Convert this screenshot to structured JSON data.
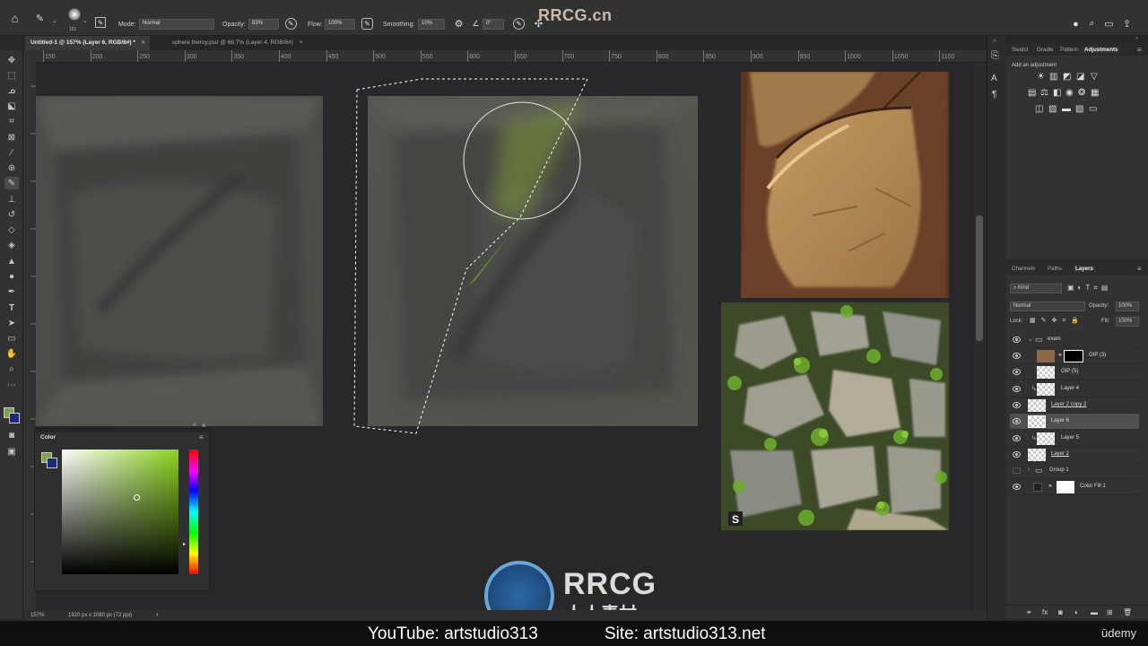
{
  "options_bar": {
    "brush_size": "151",
    "mode_label": "Mode:",
    "mode_value": "Normal",
    "opacity_label": "Opacity:",
    "opacity_value": "83%",
    "flow_label": "Flow:",
    "flow_value": "100%",
    "smoothing_label": "Smoothing:",
    "smoothing_value": "10%",
    "angle_value": "0°"
  },
  "document_tabs": [
    {
      "label": "Untitled-1 @ 157% (Layer 6, RGB/8#) *",
      "active": true
    },
    {
      "label": "sphere theroy.psd @ 66.7% (Layer 4, RGB/8#)",
      "active": false
    }
  ],
  "ruler": {
    "ticks": [
      "150",
      "200",
      "250",
      "300",
      "350",
      "400",
      "450",
      "500",
      "550",
      "600",
      "650",
      "700",
      "750",
      "800",
      "850",
      "900",
      "950",
      "1000",
      "1050",
      "1100"
    ]
  },
  "status": {
    "zoom": "157%",
    "doc_info": "1920 px x 1080 px (72 ppi)"
  },
  "color_panel": {
    "title": "Color",
    "foreground": "#7ea24a",
    "background": "#1d2a7a",
    "hue": "#8bd41e"
  },
  "panels_top": {
    "tabs": [
      "Swatcl",
      "Gradie",
      "Pattern",
      "Adjustments"
    ],
    "active_tab": "Adjustments",
    "hint": "Add an adjustment"
  },
  "layers_panel": {
    "tabs": [
      "Channels",
      "Paths",
      "Layers"
    ],
    "active_tab": "Layers",
    "filter": "Kind",
    "blend_mode": "Normal",
    "opacity_label": "Opacity:",
    "opacity_value": "100%",
    "lock_label": "Lock:",
    "fill_label": "Fill:",
    "fill_value": "100%",
    "layers": [
      {
        "name": "exam",
        "kind": "group"
      },
      {
        "name": "OIP (3)",
        "kind": "image-mask"
      },
      {
        "name": "OIP (5)",
        "kind": "image"
      },
      {
        "name": "Layer 4",
        "kind": "clipped"
      },
      {
        "name": "Layer 2 copy 2",
        "kind": "normal"
      },
      {
        "name": "Layer 6",
        "kind": "normal",
        "selected": true
      },
      {
        "name": "Layer 5",
        "kind": "clipped"
      },
      {
        "name": "Layer 2",
        "kind": "normal"
      },
      {
        "name": "Group 1",
        "kind": "group-hidden"
      },
      {
        "name": "Color Fill 1",
        "kind": "fill"
      }
    ]
  },
  "watermark": {
    "top": "RRCG.cn",
    "logo_latin": "RRCG",
    "logo_cjk": "人人素材"
  },
  "caption": {
    "youtube": "YouTube: artstudio313",
    "site": "Site: artstudio313.net",
    "brand": "ūdemy"
  }
}
